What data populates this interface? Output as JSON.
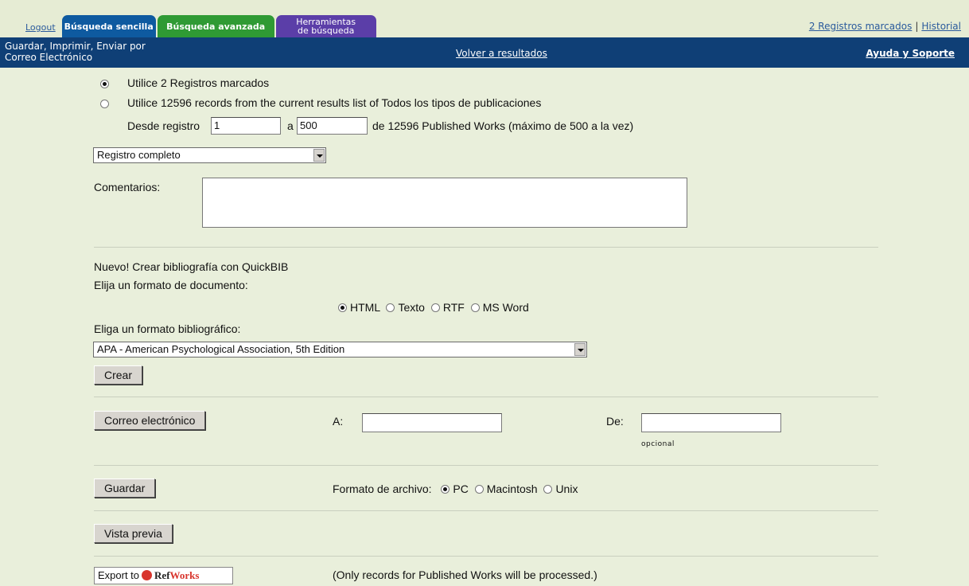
{
  "top": {
    "logout": "Logout",
    "tab_simple": "Búsqueda sencilla",
    "tab_advanced": "Búsqueda avanzada",
    "tab_tools_line1": "Herramientas",
    "tab_tools_line2": "de búsqueda",
    "marked": "2 Registros marcados",
    "history": "Historial",
    "sep": "|"
  },
  "nav": {
    "title_line1": "Guardar, Imprimir, Enviar por",
    "title_line2": "Correo Electrónico",
    "back": "Volver a resultados",
    "help": "Ayuda y Soporte"
  },
  "records": {
    "option_marked": "Utilice 2 Registros marcados",
    "option_range": "Utilice 12596 records from the current results list of Todos los tipos de publicaciones",
    "from_label": "Desde registro",
    "from_value": "1",
    "to_label": "a",
    "to_value": "500",
    "range_note": "de 12596 Published Works (máximo de 500 a la vez)",
    "format_selected": "Registro completo",
    "comments_label": "Comentarios:"
  },
  "quickbib": {
    "heading": "Nuevo! Crear bibliografía con QuickBIB",
    "doc_format_label": "Elija un formato de documento:",
    "doc_formats": [
      "HTML",
      "Texto",
      "RTF",
      "MS Word"
    ],
    "bib_format_label": "Eliga un formato bibliográfico:",
    "bib_format_selected": "APA - American Psychological Association, 5th Edition",
    "create_button": "Crear"
  },
  "email": {
    "button": "Correo electrónico",
    "to_label": "A:",
    "from_label": "De:",
    "optional": "opcional"
  },
  "save": {
    "button": "Guardar",
    "file_format_label": "Formato de archivo:",
    "formats": [
      "PC",
      "Macintosh",
      "Unix"
    ]
  },
  "preview": {
    "button": "Vista previa"
  },
  "export": {
    "prefix": "Export to",
    "ref": "Ref",
    "works": "Works",
    "note": "(Only records for Published Works will be processed.)"
  }
}
